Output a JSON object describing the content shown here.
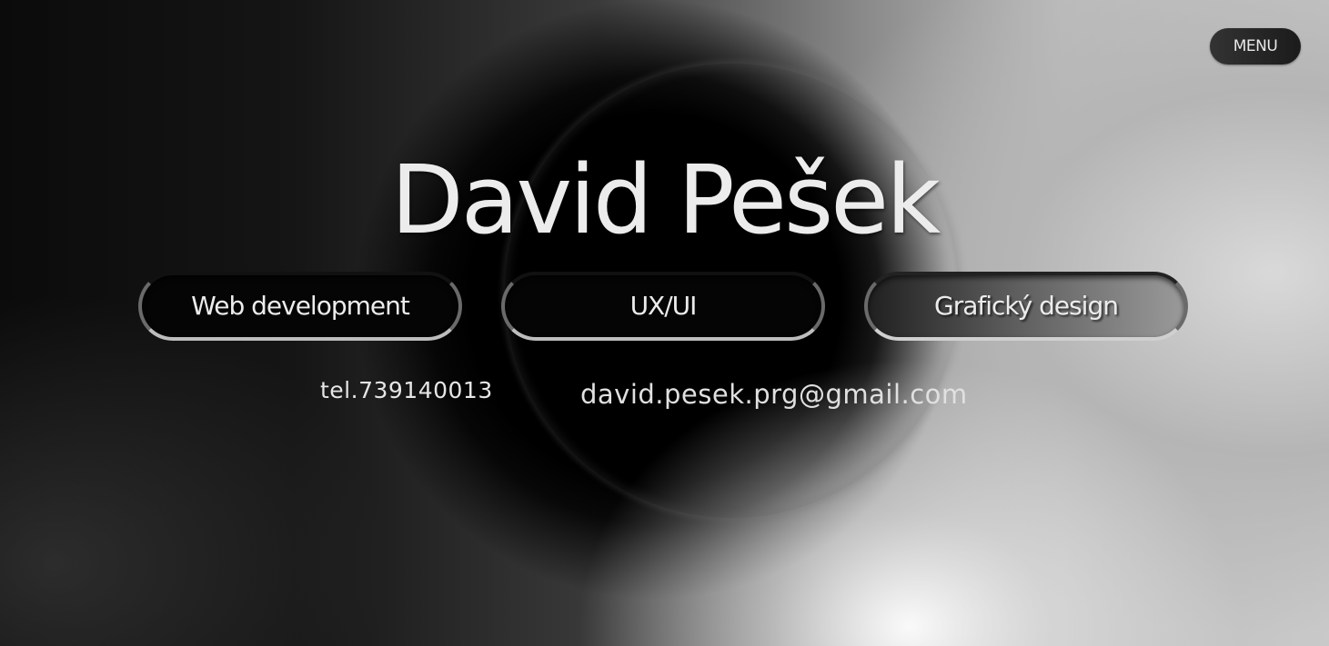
{
  "header": {
    "menu_label": "MENU"
  },
  "hero": {
    "name": "David Pešek"
  },
  "services": [
    {
      "label": "Web development"
    },
    {
      "label": "UX/UI"
    },
    {
      "label": "Grafický design"
    }
  ],
  "contact": {
    "phone": "tel.739140013",
    "email": "david.pesek.prg@gmail.com"
  }
}
